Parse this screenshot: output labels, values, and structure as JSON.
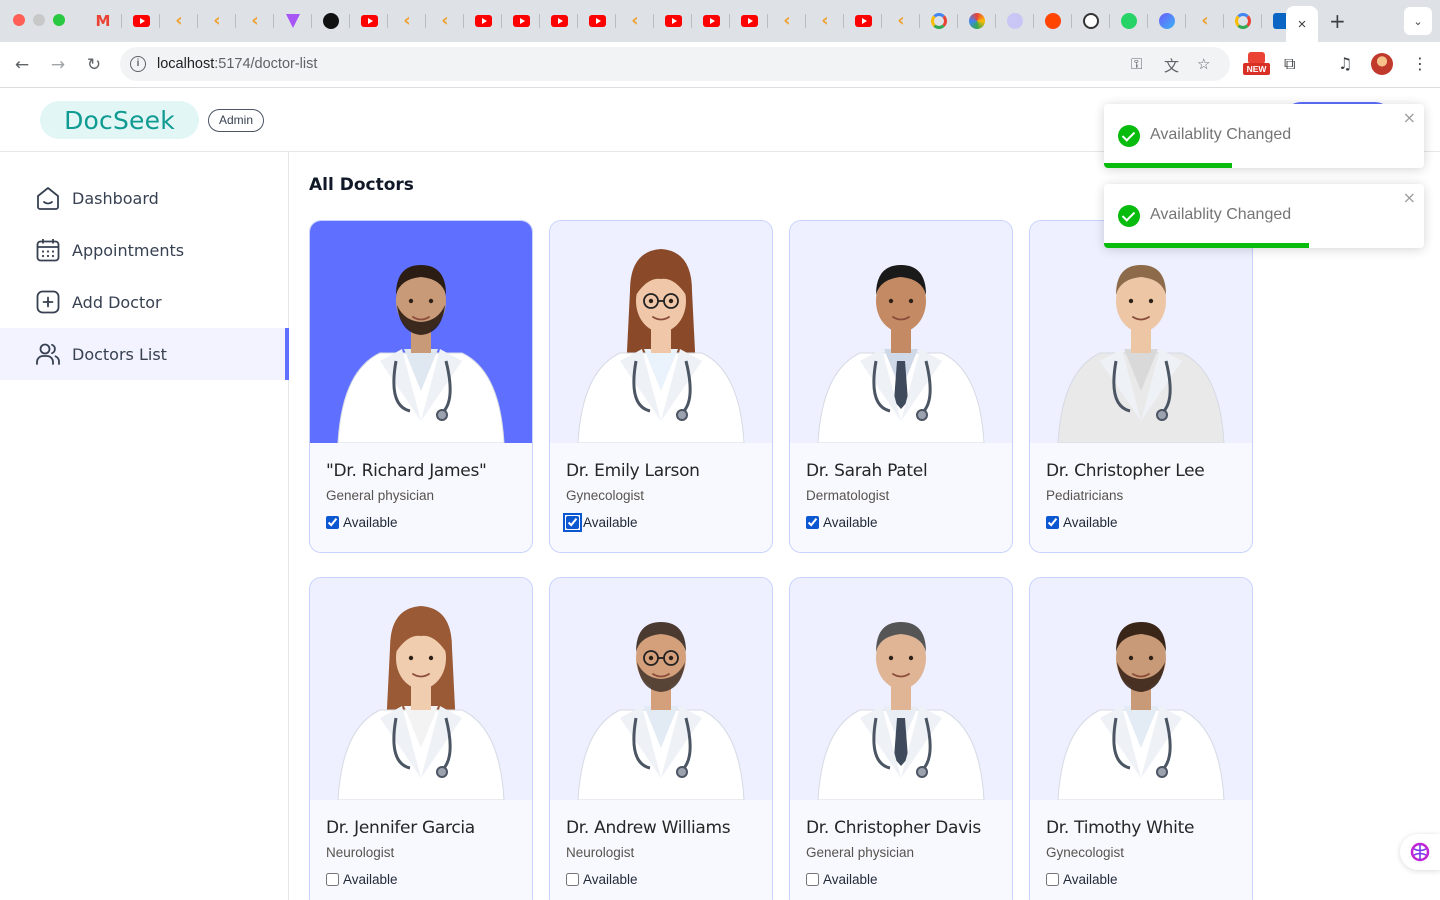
{
  "browser": {
    "active_tab_close": "×",
    "new_tab": "+",
    "tabs_menu": "⌄",
    "url_host": "localhost",
    "url_path": ":5174/doctor-list",
    "new_badge": "NEW"
  },
  "header": {
    "logo": "DocSeek",
    "role_badge": "Admin"
  },
  "sidebar": {
    "items": [
      {
        "label": "Dashboard",
        "icon": "home-icon",
        "active": false
      },
      {
        "label": "Appointments",
        "icon": "calendar-icon",
        "active": false
      },
      {
        "label": "Add Doctor",
        "icon": "add-icon",
        "active": false
      },
      {
        "label": "Doctors List",
        "icon": "people-icon",
        "active": true
      }
    ]
  },
  "main": {
    "title": "All Doctors",
    "doctors": [
      {
        "name": "\"Dr. Richard James\"",
        "speciality": "General physician",
        "available": true,
        "available_label": "Available",
        "highlighted": true
      },
      {
        "name": "Dr. Emily Larson",
        "speciality": "Gynecologist",
        "available": true,
        "available_label": "Available",
        "focused": true
      },
      {
        "name": "Dr. Sarah Patel",
        "speciality": "Dermatologist",
        "available": true,
        "available_label": "Available"
      },
      {
        "name": "Dr. Christopher Lee",
        "speciality": "Pediatricians",
        "available": true,
        "available_label": "Available"
      },
      {
        "name": "Dr. Jennifer Garcia",
        "speciality": "Neurologist",
        "available": false,
        "available_label": "Available"
      },
      {
        "name": "Dr. Andrew Williams",
        "speciality": "Neurologist",
        "available": false,
        "available_label": "Available"
      },
      {
        "name": "Dr. Christopher Davis",
        "speciality": "General physician",
        "available": false,
        "available_label": "Available"
      },
      {
        "name": "Dr. Timothy White",
        "speciality": "Gynecologist",
        "available": false,
        "available_label": "Available"
      }
    ]
  },
  "toasts": [
    {
      "message": "Availablity Changed",
      "close": "×",
      "progress": 0.4
    },
    {
      "message": "Availablity Changed",
      "close": "×",
      "progress": 0.64
    }
  ],
  "colors": {
    "primary": "#5f6fff",
    "logo_teal": "#0f9a92",
    "toast_success": "#07bc0c",
    "card_border": "#c7d2fe",
    "photo_bg": "#eef0ff"
  }
}
